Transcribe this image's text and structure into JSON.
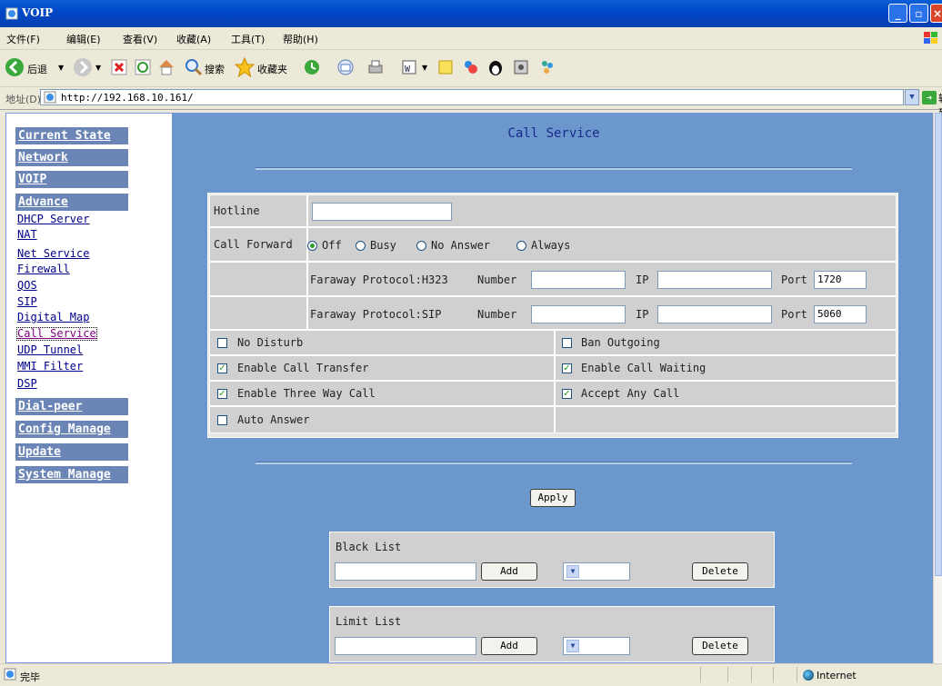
{
  "window": {
    "title": "VOIP"
  },
  "menu": [
    "文件(F)",
    "编辑(E)",
    "查看(V)",
    "收藏(A)",
    "工具(T)",
    "帮助(H)"
  ],
  "toolbar": {
    "back_label": "后退",
    "search_label": "搜索",
    "favorites_label": "收藏夹"
  },
  "address": {
    "label": "地址(D)",
    "url": "http://192.168.10.161/",
    "go_label": "转到"
  },
  "sidebar": {
    "headers": [
      "Current State",
      "Network",
      "VOIP",
      "Advance"
    ],
    "links": [
      "DHCP Server",
      "NAT",
      "Net Service",
      "Firewall",
      "QOS",
      "SIP",
      "Digital Map",
      "Call Service",
      "UDP Tunnel",
      "MMI Filter",
      "DSP"
    ],
    "footer_headers": [
      "Dial-peer",
      "Config Manage",
      "Update",
      "System Manage"
    ]
  },
  "page": {
    "title": "Call Service"
  },
  "form": {
    "hotline_label": "Hotline",
    "hotline_value": "",
    "call_forward_label": "Call Forward",
    "call_forward_options": [
      "Off",
      "Busy",
      "No Answer",
      "Always"
    ],
    "call_forward_selected": "Off",
    "faraway_h323": {
      "protocol": "Faraway Protocol:H323",
      "number_label": "Number",
      "number": "",
      "ip_label": "IP",
      "ip": "",
      "port_label": "Port",
      "port": "1720"
    },
    "faraway_sip": {
      "protocol": "Faraway Protocol:SIP",
      "number_label": "Number",
      "number": "",
      "ip_label": "IP",
      "ip": "",
      "port_label": "Port",
      "port": "5060"
    },
    "checkboxes": {
      "no_disturb": {
        "label": "No Disturb",
        "checked": false
      },
      "ban_outgoing": {
        "label": "Ban Outgoing",
        "checked": false
      },
      "call_transfer": {
        "label": "Enable Call Transfer",
        "checked": true
      },
      "call_waiting": {
        "label": "Enable Call Waiting",
        "checked": true
      },
      "three_way": {
        "label": "Enable Three Way Call",
        "checked": true
      },
      "accept_any": {
        "label": "Accept Any Call",
        "checked": true
      },
      "auto_answer": {
        "label": "Auto Answer",
        "checked": false
      }
    },
    "apply_label": "Apply"
  },
  "black_list": {
    "title": "Black List",
    "add_label": "Add",
    "delete_label": "Delete"
  },
  "limit_list": {
    "title": "Limit List",
    "add_label": "Add",
    "delete_label": "Delete"
  },
  "status": {
    "text": "完毕",
    "zone": "Internet"
  },
  "colors": {
    "main_bg": "#6b97cc",
    "nav_header_bg": "#6b86b6",
    "title_color": "#1a2a8c",
    "title_bar": "#0048c8"
  }
}
